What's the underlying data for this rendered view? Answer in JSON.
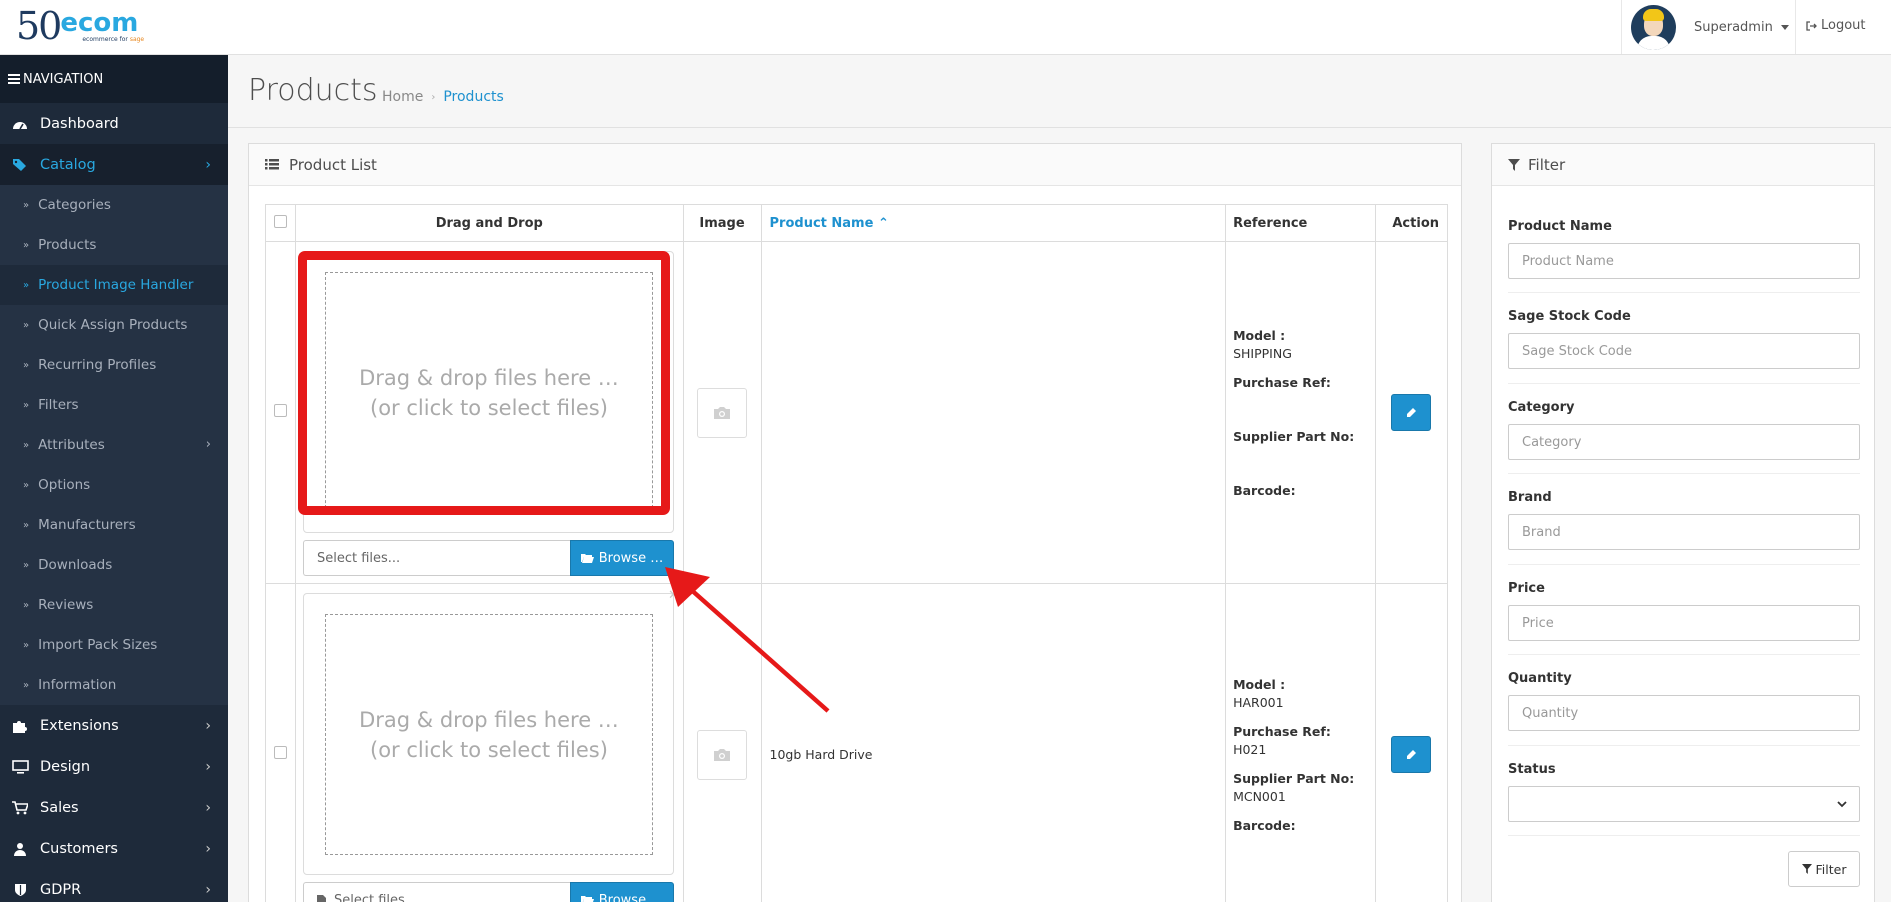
{
  "logo": {
    "number": "50",
    "brand": "ecom",
    "tagline_prefix": "ecommerce for",
    "tagline_brand": "sage"
  },
  "header": {
    "user_name": "Superadmin",
    "logout_label": "Logout"
  },
  "sidebar": {
    "heading": "NAVIGATION",
    "items": [
      {
        "label": "Dashboard",
        "icon": "dashboard-icon"
      },
      {
        "label": "Catalog",
        "icon": "tags-icon",
        "active": true
      },
      {
        "label": "Categories"
      },
      {
        "label": "Products"
      },
      {
        "label": "Product Image Handler",
        "active": true
      },
      {
        "label": "Quick Assign Products"
      },
      {
        "label": "Recurring Profiles"
      },
      {
        "label": "Filters"
      },
      {
        "label": "Attributes"
      },
      {
        "label": "Options"
      },
      {
        "label": "Manufacturers"
      },
      {
        "label": "Downloads"
      },
      {
        "label": "Reviews"
      },
      {
        "label": "Import Pack Sizes"
      },
      {
        "label": "Information"
      },
      {
        "label": "Extensions",
        "icon": "puzzle-icon"
      },
      {
        "label": "Design",
        "icon": "monitor-icon"
      },
      {
        "label": "Sales",
        "icon": "cart-icon"
      },
      {
        "label": "Customers",
        "icon": "user-icon"
      },
      {
        "label": "GDPR",
        "icon": "shield-icon"
      }
    ]
  },
  "page": {
    "title": "Products",
    "breadcrumb": [
      "Home",
      "Products"
    ]
  },
  "product_list": {
    "heading": "Product List",
    "columns": [
      "Drag and Drop",
      "Image",
      "Product Name",
      "Reference",
      "Action"
    ],
    "dropzone_text_line1": "Drag & drop files here …",
    "dropzone_text_line2": "(or click to select files)",
    "select_placeholder": "Select files...",
    "browse_label": "Browse …",
    "reference_labels": {
      "model": "Model :",
      "purchase_ref": "Purchase Ref:",
      "supplier_part": "Supplier Part No:",
      "barcode": "Barcode:"
    },
    "rows": [
      {
        "product_name": "",
        "model": "SHIPPING",
        "purchase_ref": "",
        "supplier_part": "",
        "barcode": ""
      },
      {
        "product_name": "10gb Hard Drive",
        "model": "HAR001",
        "purchase_ref": "H021",
        "supplier_part": "MCN001",
        "barcode": ""
      }
    ]
  },
  "filter": {
    "heading": "Filter",
    "fields": [
      {
        "label": "Product Name",
        "placeholder": "Product Name"
      },
      {
        "label": "Sage Stock Code",
        "placeholder": "Sage Stock Code"
      },
      {
        "label": "Category",
        "placeholder": "Category"
      },
      {
        "label": "Brand",
        "placeholder": "Brand"
      },
      {
        "label": "Price",
        "placeholder": "Price"
      },
      {
        "label": "Quantity",
        "placeholder": "Quantity"
      }
    ],
    "status_label": "Status",
    "status_value": "",
    "button_label": "Filter"
  },
  "colors": {
    "accent": "#1e91cf",
    "sidebar_bg": "#1e2a3a",
    "highlight": "#e61919"
  }
}
